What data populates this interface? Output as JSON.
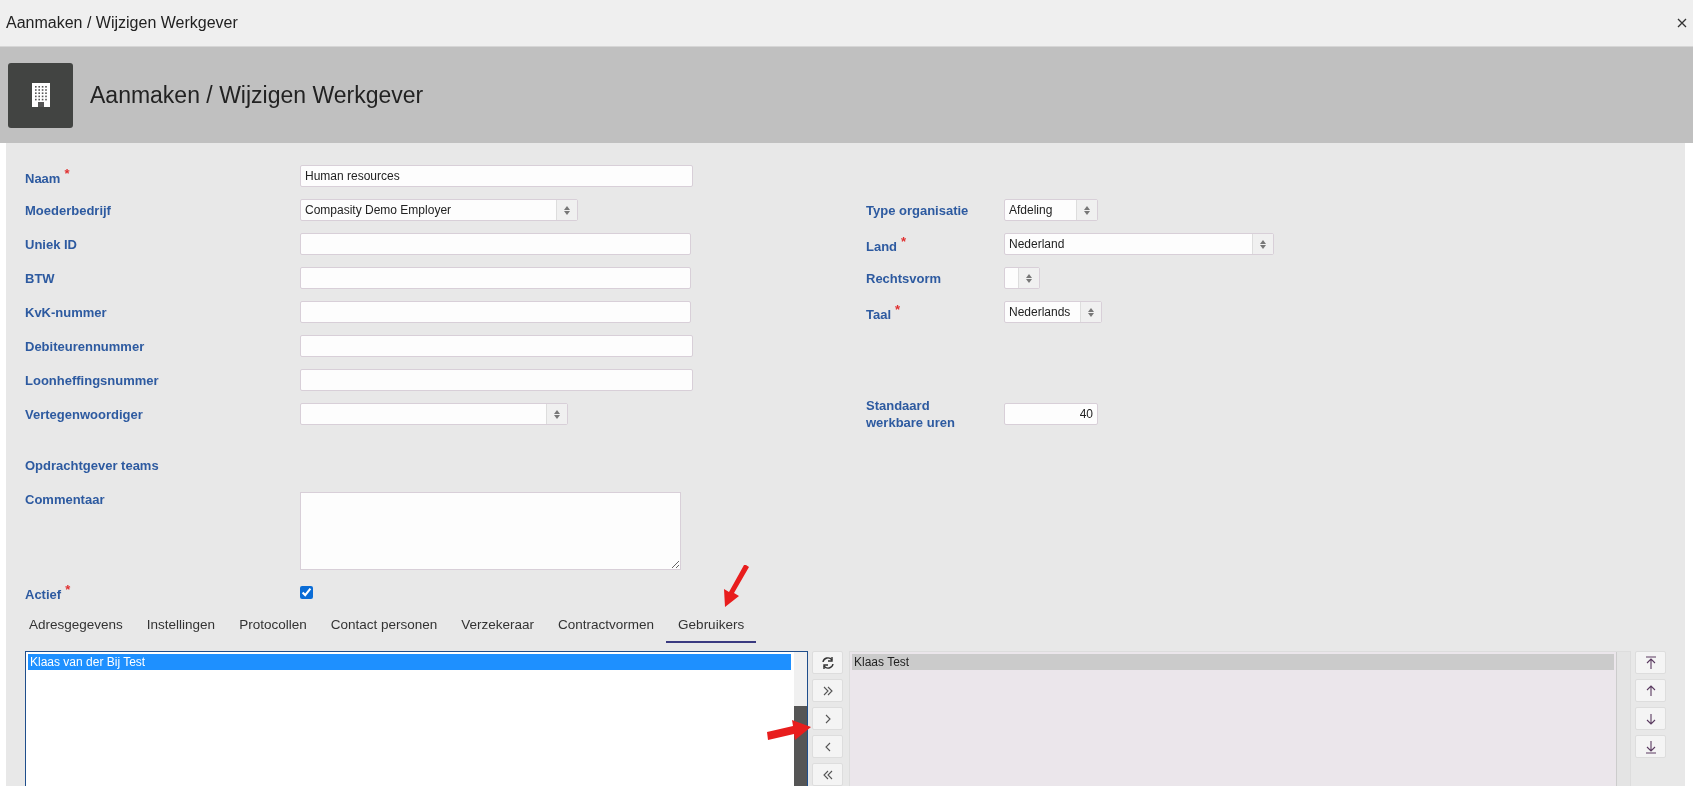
{
  "window": {
    "title": "Aanmaken / Wijzigen Werkgever"
  },
  "header": {
    "title": "Aanmaken / Wijzigen Werkgever"
  },
  "left_fields": [
    {
      "label": "Naam",
      "required_mark": "*",
      "kind": "text",
      "value": "Human resources"
    },
    {
      "label": "Moederbedrijf",
      "kind": "select",
      "value": "Compasity Demo Employer"
    },
    {
      "label": "Uniek ID",
      "kind": "text"
    },
    {
      "label": "BTW",
      "kind": "text"
    },
    {
      "label": "KvK-nummer",
      "kind": "text"
    },
    {
      "label": "Debiteurennummer",
      "kind": "text"
    },
    {
      "label": "Loonheffingsnummer",
      "kind": "text"
    },
    {
      "label": "Vertegenwoordiger",
      "kind": "select"
    }
  ],
  "right_fields": [
    {
      "label": "Type organisatie",
      "kind": "select",
      "value": "Afdeling"
    },
    {
      "label": "Land",
      "required_mark": "*",
      "kind": "select",
      "value": "Nederland"
    },
    {
      "label": "Rechtsvorm",
      "kind": "select"
    },
    {
      "label": "Taal",
      "required_mark": "*",
      "kind": "select",
      "value": "Nederlands"
    },
    {
      "label": "Standaard werkbare uren",
      "kind": "number",
      "value": "40"
    }
  ],
  "teams_label": "Opdrachtgever teams",
  "comment": {
    "label": "Commentaar"
  },
  "active": {
    "label": "Actief",
    "required_mark": "*",
    "checked": true
  },
  "tabs": [
    {
      "label": "Adresgegevens",
      "selected": false
    },
    {
      "label": "Instellingen",
      "selected": false
    },
    {
      "label": "Protocollen",
      "selected": false
    },
    {
      "label": "Contact personen",
      "selected": false
    },
    {
      "label": "Verzekeraar",
      "selected": false
    },
    {
      "label": "Contractvormen",
      "selected": false
    },
    {
      "label": "Gebruikers",
      "selected": true
    }
  ],
  "available_users": [
    {
      "name": "Klaas van der Bij Test",
      "selected": true
    }
  ],
  "assigned_users": [
    {
      "name": "Klaas Test",
      "selected": true
    }
  ]
}
